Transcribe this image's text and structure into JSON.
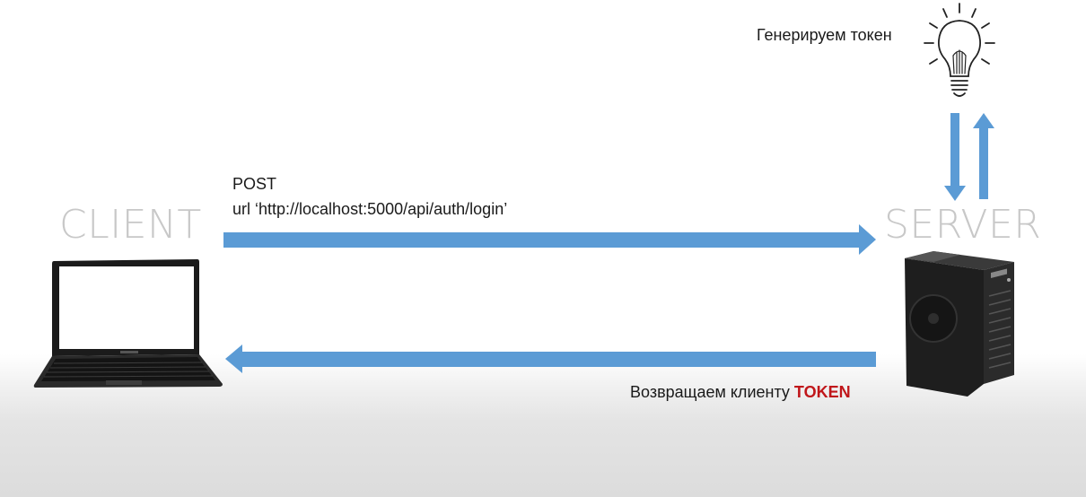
{
  "diagram": {
    "client_label": "CLIENT",
    "server_label": "SERVER",
    "request": {
      "method": "POST",
      "url": "url ‘http://localhost:5000/api/auth/login’"
    },
    "generate_label": "Генерируем токен",
    "response": {
      "text": "Возвращаем клиенту",
      "token": "TOKEN"
    },
    "colors": {
      "arrow": "#5b9bd5",
      "token": "#c0161a",
      "label_gray": "#c8c8c8"
    },
    "icons": [
      "laptop-icon",
      "server-tower-icon",
      "lightbulb-icon"
    ]
  }
}
